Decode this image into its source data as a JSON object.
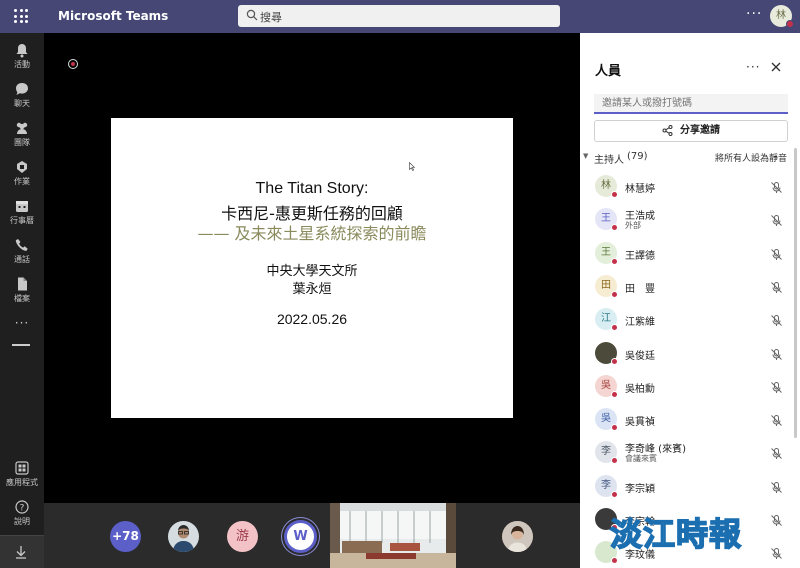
{
  "titlebar": {
    "app_title": "Microsoft Teams",
    "search_placeholder": "搜尋",
    "more_label": "···",
    "avatar_initial": "林"
  },
  "rail": {
    "items": [
      {
        "label": "活動",
        "icon": "bell-icon"
      },
      {
        "label": "聊天",
        "icon": "chat-icon"
      },
      {
        "label": "團隊",
        "icon": "teams-icon"
      },
      {
        "label": "作業",
        "icon": "assignments-icon"
      },
      {
        "label": "行事曆",
        "icon": "calendar-icon"
      },
      {
        "label": "通話",
        "icon": "phone-icon"
      },
      {
        "label": "檔案",
        "icon": "file-icon"
      }
    ],
    "more": "···",
    "apps_label": "應用程式",
    "help_label": "說明"
  },
  "slide": {
    "line1": "The Titan Story:",
    "line2": "卡西尼-惠更斯任務的回顧",
    "line3": "—— 及未來土星系統探索的前瞻",
    "line4": "中央大學天文所",
    "line5": "葉永烜",
    "line6": "2022.05.26"
  },
  "strip": {
    "overflow_count": "+78",
    "pill_you": "游",
    "pill_w": "W"
  },
  "panel": {
    "title": "人員",
    "invite_placeholder": "邀請某人或撥打號碼",
    "share_label": "分享邀請",
    "host_label": "主持人",
    "host_count": "(79)",
    "mute_all": "將所有人設為靜音",
    "participants": [
      {
        "initial": "林",
        "name": "林慧婷",
        "sub": "",
        "bg": "#e6ead8",
        "fg": "#6b7047"
      },
      {
        "initial": "王",
        "name": "王浩成",
        "sub": "外部",
        "bg": "#e4e5f6",
        "fg": "#5b5fc7"
      },
      {
        "initial": "王",
        "name": "王譯德",
        "sub": "",
        "bg": "#e3eedb",
        "fg": "#5d7a3a"
      },
      {
        "initial": "田",
        "name": "田　豐",
        "sub": "",
        "bg": "#f6ecd2",
        "fg": "#8a6a1e"
      },
      {
        "initial": "江",
        "name": "江紫維",
        "sub": "",
        "bg": "#d9eef2",
        "fg": "#2b7a88"
      },
      {
        "initial": "",
        "name": "吳俊廷",
        "sub": "",
        "bg": "#4c4a3a",
        "fg": "#fff"
      },
      {
        "initial": "吳",
        "name": "吳柏勳",
        "sub": "",
        "bg": "#f4d5d1",
        "fg": "#a3413a"
      },
      {
        "initial": "吳",
        "name": "吳貫禎",
        "sub": "",
        "bg": "#dbe4f5",
        "fg": "#3d5ea5"
      },
      {
        "initial": "李",
        "name": "李奇峰 (來賓)",
        "sub": "會議來賓",
        "bg": "#e1e4ea",
        "fg": "#4c5666"
      },
      {
        "initial": "李",
        "name": "李宗穎",
        "sub": "",
        "bg": "#dde3ef",
        "fg": "#455a80"
      },
      {
        "initial": "",
        "name": "李宗翰",
        "sub": "",
        "bg": "#3a3a3a",
        "fg": "#fff"
      },
      {
        "initial": "",
        "name": "李玟儀",
        "sub": "",
        "bg": "#d7e8cf",
        "fg": "#fff"
      }
    ]
  },
  "watermark": "淡江時報",
  "colors": {
    "titlebar": "#464775",
    "accent": "#5b5fc7",
    "presence_busy": "#c4314b"
  }
}
